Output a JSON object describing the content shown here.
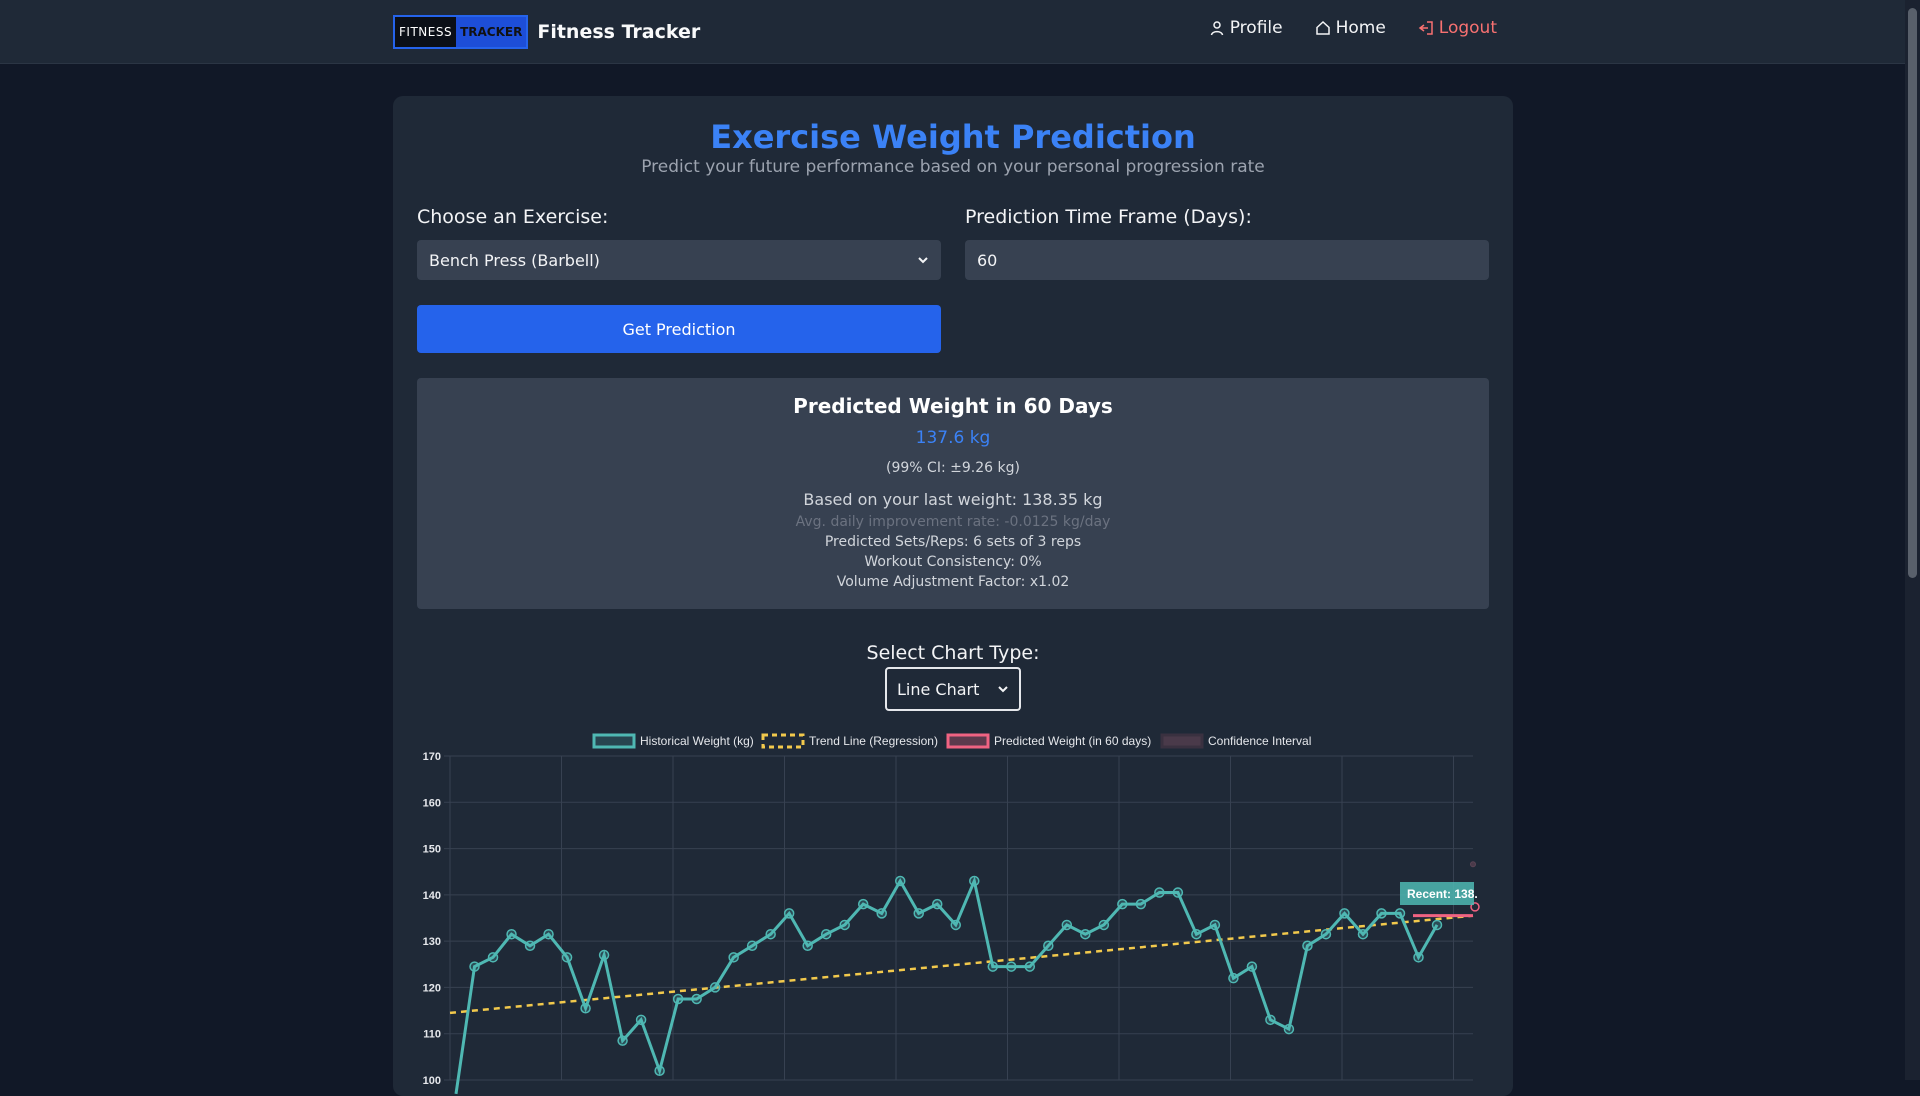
{
  "navbar": {
    "logo_part1": "FITNESS",
    "logo_part2": "TRACKER",
    "title": "Fitness Tracker",
    "profile_label": "Profile",
    "home_label": "Home",
    "logout_label": "Logout"
  },
  "header": {
    "title": "Exercise Weight Prediction",
    "subtitle": "Predict your future performance based on your personal progression rate"
  },
  "form": {
    "exercise_label": "Choose an Exercise:",
    "exercise_value": "Bench Press (Barbell)",
    "timeframe_label": "Prediction Time Frame (Days):",
    "timeframe_value": "60",
    "button_label": "Get Prediction"
  },
  "result": {
    "title": "Predicted Weight in 60 Days",
    "weight": "137.6 kg",
    "ci": "(99% CI: ±9.26 kg)",
    "based_on": "Based on your last weight: 138.35 kg",
    "rate": "Avg. daily improvement rate: -0.0125 kg/day",
    "sets_reps": "Predicted Sets/Reps: 6 sets of 3 reps",
    "consistency": "Workout Consistency: 0%",
    "volume": "Volume Adjustment Factor: x1.02"
  },
  "chart_controls": {
    "label": "Select Chart Type:",
    "value": "Line Chart"
  },
  "colors": {
    "historical": "#4fb8b3",
    "trend": "#f2c94c",
    "predicted": "#f06382",
    "confidence": "#4a3a4a",
    "accent": "#3b82f6"
  },
  "chart_data": {
    "type": "line",
    "legend": [
      "Historical Weight (kg)",
      "Trend Line (Regression)",
      "Predicted Weight (in 60 days)",
      "Confidence Interval"
    ],
    "legend_position": "top",
    "grid": true,
    "ylim": [
      100,
      170
    ],
    "yticks": [
      100,
      110,
      120,
      130,
      140,
      150,
      160,
      170
    ],
    "series": [
      {
        "name": "Historical Weight (kg)",
        "values": [
          97.0,
          124.5,
          126.5,
          131.5,
          129.0,
          131.5,
          126.5,
          115.5,
          127.0,
          108.5,
          113.0,
          102.0,
          117.5,
          117.5,
          120.0,
          126.5,
          129.0,
          131.5,
          136.0,
          129.0,
          131.5,
          133.5,
          138.0,
          136.0,
          143.0,
          136.0,
          138.0,
          133.5,
          143.0,
          124.5,
          124.5,
          124.5,
          129.0,
          133.5,
          131.5,
          133.5,
          138.0,
          138.0,
          140.5,
          140.5,
          131.5,
          133.5,
          122.0,
          124.5,
          113.0,
          111.0,
          129.0,
          131.5,
          136.0,
          131.5,
          136.0,
          136.0,
          126.5,
          133.5
        ]
      },
      {
        "name": "Trend Line (Regression)",
        "values_start": 114.5,
        "values_end": 135.5
      }
    ],
    "annotation": "Recent: 138."
  }
}
